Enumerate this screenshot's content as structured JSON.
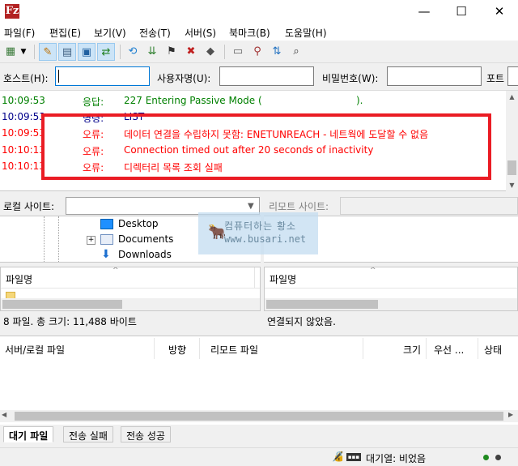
{
  "window": {
    "app_icon": "Fz",
    "minimize": "—",
    "maximize": "☐",
    "close": "✕"
  },
  "menu": [
    "파일(F)",
    "편집(E)",
    "보기(V)",
    "전송(T)",
    "서버(S)",
    "북마크(B)",
    "도움말(H)"
  ],
  "quickconnect": {
    "host_label": "호스트(H):",
    "user_label": "사용자명(U):",
    "pass_label": "비밀번호(W):",
    "port_label": "포트",
    "host_value": "",
    "user_value": "",
    "pass_value": "",
    "port_value": ""
  },
  "log": [
    {
      "time": "10:09:53",
      "type": "응답:",
      "msg": "227 Entering Passive Mode (",
      "msg2": ").",
      "color": "#008000"
    },
    {
      "time": "10:09:53",
      "type": "명령:",
      "msg": "LIST",
      "msg2": "",
      "color": "#00008b"
    },
    {
      "time": "10:09:53",
      "type": "오류:",
      "msg": "데이터 연결을 수립하지 못함: ENETUNREACH - 네트웍에 도달할 수 없음",
      "msg2": "",
      "color": "#ff0000"
    },
    {
      "time": "10:10:13",
      "type": "오류:",
      "msg": "Connection timed out after 20 seconds of inactivity",
      "msg2": "",
      "color": "#ff0000"
    },
    {
      "time": "10:10:13",
      "type": "오류:",
      "msg": "디렉터리 목록 조회 실패",
      "msg2": "",
      "color": "#ff0000"
    }
  ],
  "local_site": {
    "label": "로컬 사이트:",
    "value": ""
  },
  "remote_site": {
    "label": "리모트 사이트:",
    "value": ""
  },
  "local_tree": [
    "Desktop",
    "Documents",
    "Downloads"
  ],
  "local_files": {
    "header": "파일명",
    "status": "8 파일. 총 크기: 11,488 바이트"
  },
  "remote_files": {
    "header": "파일명",
    "status": "연결되지 않았음."
  },
  "queue": {
    "columns": [
      "서버/로컬 파일",
      "방향",
      "리모트 파일",
      "크기",
      "우선 ...",
      "상태"
    ]
  },
  "tabs": [
    "대기 파일",
    "전송 실패",
    "전송 성공"
  ],
  "statusbar": {
    "queue_text": "대기열: 비었음"
  },
  "watermark": {
    "line1": "컴퓨터하는 황소",
    "line2": "www.busari.net"
  }
}
